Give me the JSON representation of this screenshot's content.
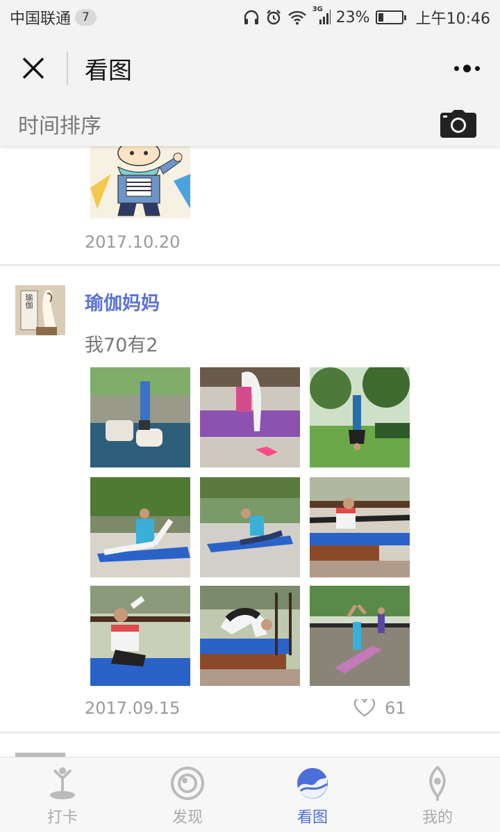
{
  "status_bar": {
    "carrier": "中国联通",
    "notification_count": "7",
    "battery_percent": "23%",
    "battery_level": 0.23,
    "time": "上午10:46",
    "network_type": "3G",
    "icons": [
      "headphones-icon",
      "alarm-icon",
      "wifi-icon",
      "signal-icon",
      "battery-icon"
    ]
  },
  "titlebar": {
    "title": "看图",
    "close_icon": "close-icon",
    "more_icon": "more-dots-icon"
  },
  "sortbar": {
    "label": "时间排序",
    "camera_icon": "camera-icon"
  },
  "feed": {
    "top_post": {
      "date": "2017.10.20"
    },
    "post": {
      "username": "瑜伽妈妈",
      "text": "我70有2",
      "date": "2017.09.15",
      "likes": "61",
      "avatar_text": "瑜伽"
    }
  },
  "tabbar": {
    "tabs": [
      {
        "label": "打卡",
        "icon": "yoga-pose-icon"
      },
      {
        "label": "发现",
        "icon": "eye-icon"
      },
      {
        "label": "看图",
        "icon": "wave-circle-icon"
      },
      {
        "label": "我的",
        "icon": "lotus-person-icon"
      }
    ],
    "active_index": 2
  },
  "colors": {
    "accent": "#4a6fd8",
    "username": "#5b72d8",
    "bar_bg": "#f3f3f3"
  }
}
